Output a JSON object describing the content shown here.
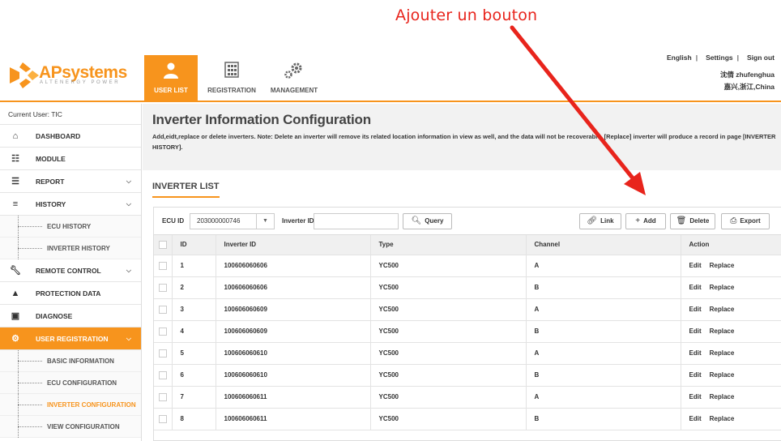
{
  "annotation": {
    "text": "Ajouter un bouton",
    "color": "#e8241c"
  },
  "brand": {
    "name_ap": "AP",
    "name_rest": "systems",
    "tagline": "ALTENERGY POWER",
    "accent": "#f7941d"
  },
  "nav": {
    "tabs": [
      {
        "label": "USER LIST",
        "icon": "user-icon"
      },
      {
        "label": "REGISTRATION",
        "icon": "calculator-icon"
      },
      {
        "label": "MANAGEMENT",
        "icon": "gears-icon"
      }
    ]
  },
  "topbar": {
    "language": "English",
    "settings": "Settings",
    "signout": "Sign out",
    "user": "沈倩 zhufenghua",
    "location": "嘉兴,浙江,China"
  },
  "sidebar": {
    "current_user": "Current User: TIC",
    "items": [
      {
        "label": "DASHBOARD",
        "icon": "home-icon"
      },
      {
        "label": "MODULE",
        "icon": "grid-icon"
      },
      {
        "label": "REPORT",
        "icon": "report-icon"
      },
      {
        "label": "HISTORY",
        "icon": "database-icon"
      },
      {
        "label": "ECU HISTORY"
      },
      {
        "label": "INVERTER HISTORY"
      },
      {
        "label": "REMOTE CONTROL",
        "icon": "wrench-icon"
      },
      {
        "label": "PROTECTION DATA",
        "icon": "warning-icon"
      },
      {
        "label": "DIAGNOSE",
        "icon": "toolbox-icon"
      },
      {
        "label": "USER REGISTRATION",
        "icon": "gears-icon"
      },
      {
        "label": "BASIC INFORMATION"
      },
      {
        "label": "ECU CONFIGURATION"
      },
      {
        "label": "INVERTER CONFIGURATION"
      },
      {
        "label": "VIEW CONFIGURATION"
      }
    ]
  },
  "page": {
    "title": "Inverter Information Configuration",
    "description": "Add,eidt,replace or delete inverters. Note: Delete an inverter will remove its related location information in view as well, and the data will not be recoverable. [Replace] inverter will produce a record in page [INVERTER HISTORY].",
    "section": "INVERTER LIST"
  },
  "toolbar": {
    "ecu_label": "ECU ID",
    "ecu_value": "203000000746",
    "inverter_label": "Inverter ID",
    "inverter_placeholder": "",
    "query": "Query",
    "link": "Link",
    "add": "Add",
    "delete": "Delete",
    "export": "Export"
  },
  "table": {
    "headers": [
      "ID",
      "Inverter ID",
      "Type",
      "Channel",
      "Action"
    ],
    "action_edit": "Edit",
    "action_replace": "Replace",
    "rows": [
      {
        "id": "1",
        "inverter": "100606060606",
        "type": "YC500",
        "channel": "A"
      },
      {
        "id": "2",
        "inverter": "100606060606",
        "type": "YC500",
        "channel": "B"
      },
      {
        "id": "3",
        "inverter": "100606060609",
        "type": "YC500",
        "channel": "A"
      },
      {
        "id": "4",
        "inverter": "100606060609",
        "type": "YC500",
        "channel": "B"
      },
      {
        "id": "5",
        "inverter": "100606060610",
        "type": "YC500",
        "channel": "A"
      },
      {
        "id": "6",
        "inverter": "100606060610",
        "type": "YC500",
        "channel": "B"
      },
      {
        "id": "7",
        "inverter": "100606060611",
        "type": "YC500",
        "channel": "A"
      },
      {
        "id": "8",
        "inverter": "100606060611",
        "type": "YC500",
        "channel": "B"
      }
    ]
  }
}
